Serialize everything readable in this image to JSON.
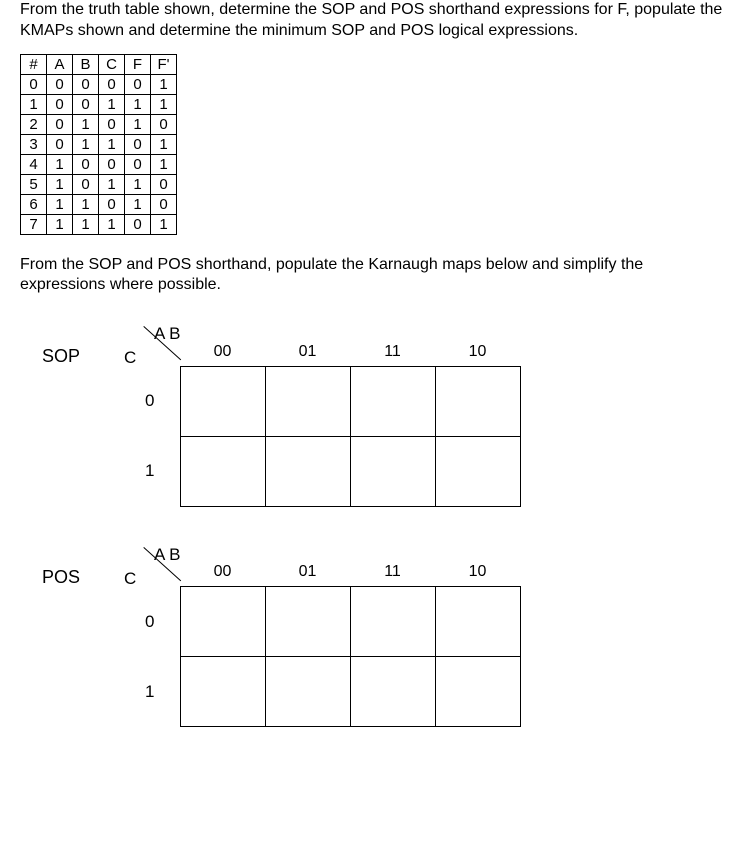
{
  "instructions": "From the truth table shown, determine the SOP and POS shorthand expressions for F, populate the KMAPs shown and determine the minimum SOP and POS logical expressions.",
  "sub_instructions": "From the SOP and POS shorthand, populate the Karnaugh maps below and simplify the expressions where possible.",
  "truth_table": {
    "headers": [
      "#",
      "A",
      "B",
      "C",
      "F",
      "F'"
    ],
    "rows": [
      [
        "0",
        "0",
        "0",
        "0",
        "0",
        "1"
      ],
      [
        "1",
        "0",
        "0",
        "1",
        "1",
        "1"
      ],
      [
        "2",
        "0",
        "1",
        "0",
        "1",
        "0"
      ],
      [
        "3",
        "0",
        "1",
        "1",
        "0",
        "1"
      ],
      [
        "4",
        "1",
        "0",
        "0",
        "0",
        "1"
      ],
      [
        "5",
        "1",
        "0",
        "1",
        "1",
        "0"
      ],
      [
        "6",
        "1",
        "1",
        "0",
        "1",
        "0"
      ],
      [
        "7",
        "1",
        "1",
        "1",
        "0",
        "1"
      ]
    ]
  },
  "chart_data": [
    {
      "type": "table",
      "title": "SOP",
      "corner_top": "A B",
      "corner_left": "C",
      "col_headers": [
        "00",
        "01",
        "11",
        "10"
      ],
      "row_headers": [
        "0",
        "1"
      ],
      "cells": [
        [
          "",
          "",
          "",
          ""
        ],
        [
          "",
          "",
          "",
          ""
        ]
      ]
    },
    {
      "type": "table",
      "title": "POS",
      "corner_top": "A B",
      "corner_left": "C",
      "col_headers": [
        "00",
        "01",
        "11",
        "10"
      ],
      "row_headers": [
        "0",
        "1"
      ],
      "cells": [
        [
          "",
          "",
          "",
          ""
        ],
        [
          "",
          "",
          "",
          ""
        ]
      ]
    }
  ]
}
